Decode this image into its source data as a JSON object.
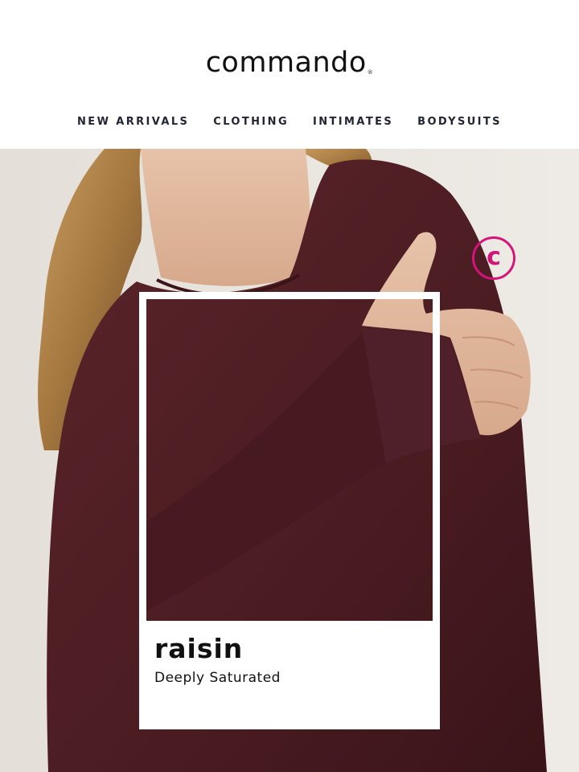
{
  "header": {
    "logo": "commando",
    "logo_mark": "®",
    "nav": [
      {
        "label": "NEW ARRIVALS"
      },
      {
        "label": "CLOTHING"
      },
      {
        "label": "INTIMATES"
      },
      {
        "label": "BODYSUITS"
      }
    ]
  },
  "hero": {
    "badge_letter": "c",
    "colors": {
      "badge": "#d4147a",
      "garment": "#4a1c22",
      "background": "#e9e5df"
    }
  },
  "swatch": {
    "name": "raisin",
    "description": "Deeply Saturated"
  }
}
